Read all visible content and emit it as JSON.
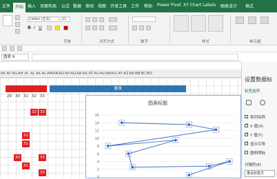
{
  "ribbon_tabs": [
    "文件",
    "开始",
    "插入",
    "页面布局",
    "公式",
    "数据",
    "审阅",
    "视图",
    "开发工具",
    "工作",
    "帮助",
    "Power Pivot",
    "XY Chart Labels",
    "图表设计",
    "格式"
  ],
  "selected_tab": "开始",
  "font_name": "Calibri (正文)",
  "font_size": "11",
  "group_labels": {
    "font": "字体",
    "alignment": "对齐方式",
    "number": "数字",
    "styles": "样式",
    "cells": "单元格"
  },
  "name_box": "图表 9",
  "columns": [
    "AE",
    "AF",
    "AG",
    "AH",
    "AI",
    "AJ",
    "AK",
    "AL",
    "AM",
    "AN",
    "AO",
    "AP",
    "AQ",
    "AR",
    "AS",
    "AT",
    "AU",
    "AV",
    "AW",
    "AX",
    "AY",
    "AZ",
    "BA",
    "BB",
    "BC",
    "BD"
  ],
  "header_row": [
    "29",
    "30",
    "31",
    "32",
    "33"
  ],
  "blue_banner": "篮球",
  "red_cells": [
    "32",
    "33",
    "31",
    "31",
    "30",
    "31",
    "33",
    "33"
  ],
  "chart": {
    "title": "图表标题",
    "y_ticks": [
      "16",
      "14",
      "12",
      "10",
      "8",
      "6",
      "4",
      "2",
      "0"
    ]
  },
  "chart_data": {
    "type": "scatter",
    "title": "图表标题",
    "ylim": [
      0,
      16
    ],
    "points": [
      {
        "x": 1,
        "y": 14
      },
      {
        "x": 6,
        "y": 13.5
      },
      {
        "x": 8,
        "y": 12.2
      },
      {
        "x": 0,
        "y": 8
      },
      {
        "x": 5,
        "y": 9.5
      },
      {
        "x": 1.5,
        "y": 6
      },
      {
        "x": 1.8,
        "y": 2.5
      },
      {
        "x": 7.5,
        "y": 2.8
      },
      {
        "x": 9,
        "y": 4
      },
      {
        "x": 6,
        "y": 0.5
      }
    ]
  },
  "panel": {
    "title": "设置数据标",
    "tab_label": "标签选项",
    "options": [
      {
        "label": "系列名称",
        "checked": false
      },
      {
        "label": "X 值(X)",
        "checked": true
      },
      {
        "label": "Y 值(Y)",
        "checked": true
      },
      {
        "label": "显示引导",
        "checked": true
      },
      {
        "label": "图例项标",
        "checked": false
      }
    ],
    "separator_label": "分隔符(E)",
    "reset_label": "重设标签文"
  },
  "colors": {
    "excel_green": "#217346",
    "red_cell": "#e02020",
    "blue_banner": "#2e75b6",
    "chart_line": "#4472c4"
  }
}
